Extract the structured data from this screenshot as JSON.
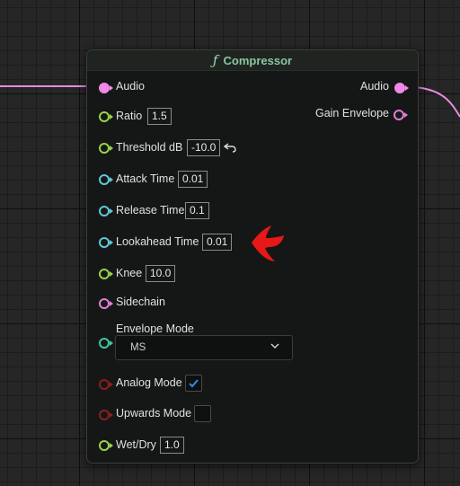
{
  "node": {
    "title": "Compressor",
    "title_icon": "function-icon",
    "accent_title_color": "#8bc6a0"
  },
  "inputs": {
    "audio": {
      "label": "Audio"
    },
    "ratio": {
      "label": "Ratio",
      "value": "1.5"
    },
    "threshold": {
      "label": "Threshold dB",
      "value": "-10.0"
    },
    "attack": {
      "label": "Attack Time",
      "value": "0.01"
    },
    "release": {
      "label": "Release Time",
      "value": "0.1"
    },
    "lookahead": {
      "label": "Lookahead Time",
      "value": "0.01"
    },
    "knee": {
      "label": "Knee",
      "value": "10.0"
    },
    "sidechain": {
      "label": "Sidechain"
    },
    "envelope_mode": {
      "label": "Envelope Mode",
      "value": "MS"
    },
    "analog_mode": {
      "label": "Analog Mode",
      "checked": true
    },
    "upwards_mode": {
      "label": "Upwards Mode",
      "checked": false
    },
    "wet_dry": {
      "label": "Wet/Dry",
      "value": "1.0"
    }
  },
  "outputs": {
    "audio": {
      "label": "Audio"
    },
    "gain_envelope": {
      "label": "Gain Envelope"
    }
  },
  "colors": {
    "audio_pin": "#f088e8",
    "float_pin": "#9ad24a",
    "time_pin": "#5fc8d8",
    "enum_pin": "#3cc8a4",
    "bool_pin": "#8a1e1e",
    "annotation_arrow": "#e81818",
    "checkbox_check": "#2f8cf0"
  }
}
